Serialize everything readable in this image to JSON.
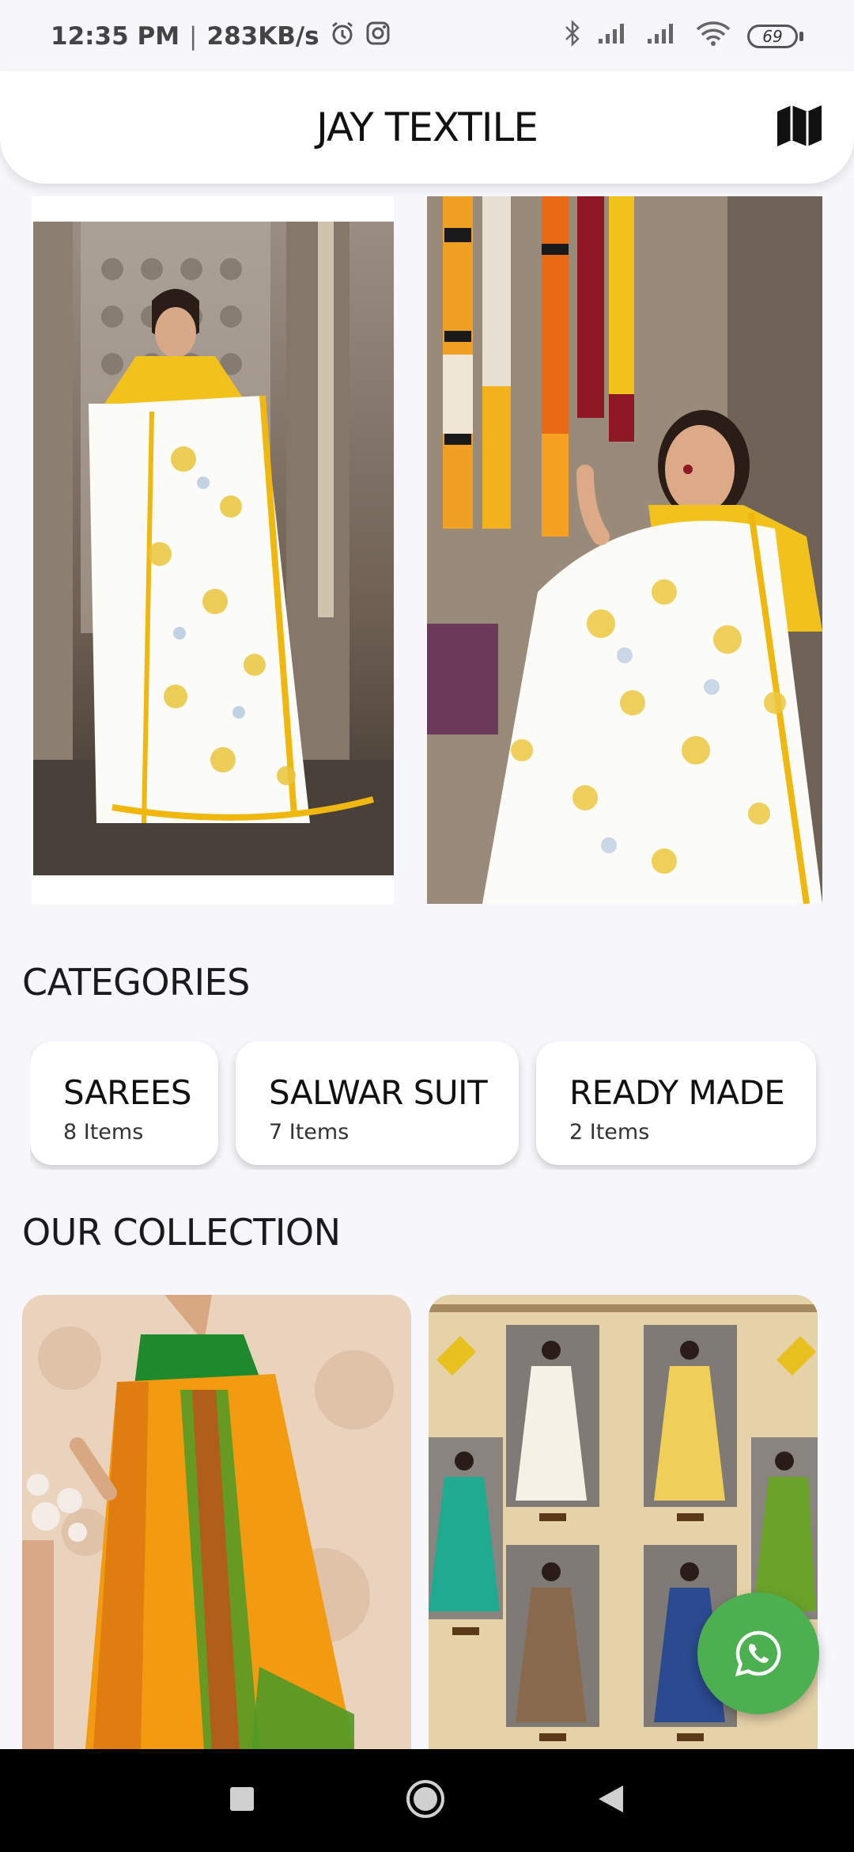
{
  "status_bar": {
    "time": "12:35 PM",
    "separator": "|",
    "speed": "283KB/s",
    "battery": "69",
    "icons": [
      "alarm-icon",
      "instagram-icon",
      "bluetooth-icon",
      "signal-icon",
      "signal-icon",
      "wifi-icon",
      "battery-icon"
    ]
  },
  "app_bar": {
    "title": "JAY TEXTILE",
    "action_icon": "map-icon"
  },
  "banner": {
    "images": [
      "saree-model-standing-photo",
      "saree-model-garlands-photo"
    ]
  },
  "categories": {
    "title": "CATEGORIES",
    "items": [
      {
        "name": "SAREES",
        "count": "8 Items"
      },
      {
        "name": "SALWAR SUIT",
        "count": "7 Items"
      },
      {
        "name": "READY MADE",
        "count": "2 Items"
      }
    ]
  },
  "collection": {
    "title": "OUR COLLECTION",
    "images": [
      "orange-saree-photo",
      "saree-catalog-collage"
    ]
  },
  "fab": {
    "icon": "whatsapp-icon",
    "color": "#4caf50"
  },
  "nav_bar": {
    "icons": [
      "recents-square-icon",
      "home-circle-icon",
      "back-triangle-icon"
    ]
  }
}
